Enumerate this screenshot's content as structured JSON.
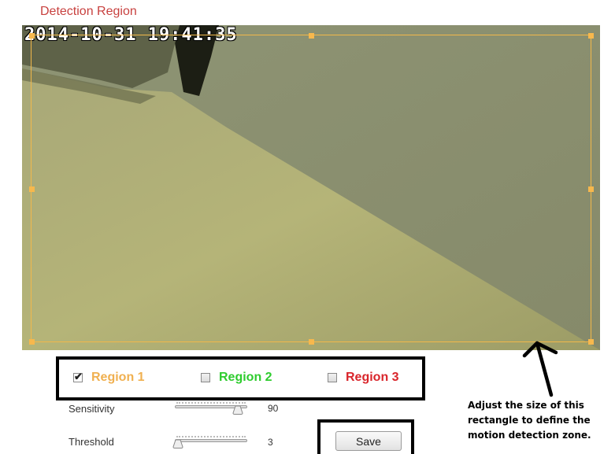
{
  "header": {
    "title": "Detection Region"
  },
  "camera": {
    "timestamp": "2014-10-31 19:41:35",
    "detection_rect_color": "#f2b84a"
  },
  "regions": [
    {
      "label": "Region 1",
      "checked": true,
      "color": "#f0b050"
    },
    {
      "label": "Region 2",
      "checked": false,
      "color": "#2ecc2e"
    },
    {
      "label": "Region 3",
      "checked": false,
      "color": "#d9252b"
    }
  ],
  "settings": {
    "sensitivity": {
      "label": "Sensitivity",
      "value": "90",
      "fraction": 0.9
    },
    "threshold": {
      "label": "Threshold",
      "value": "3",
      "fraction": 0.0
    }
  },
  "actions": {
    "save_label": "Save"
  },
  "annotation": {
    "lines": [
      "Adjust the size of this",
      "rectangle to define the",
      "motion detection zone."
    ]
  }
}
